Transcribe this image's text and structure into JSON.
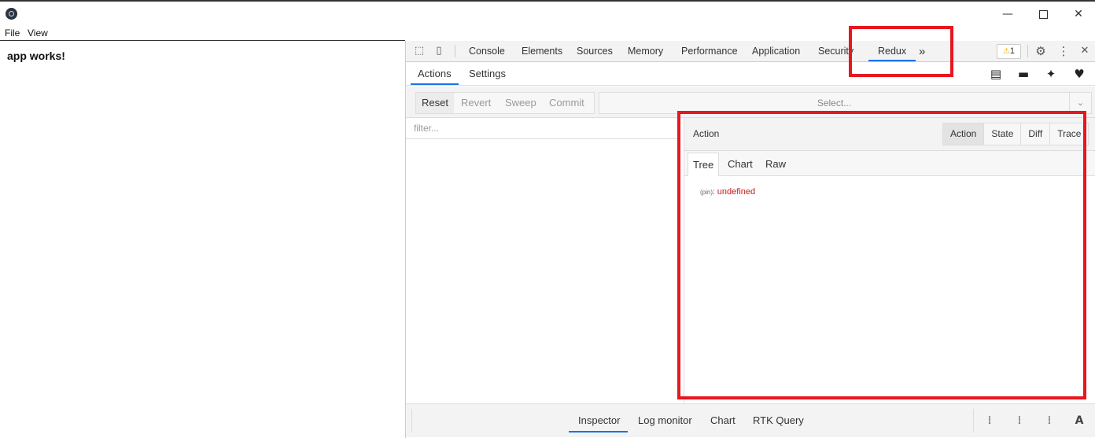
{
  "window": {
    "minimize_glyph": "—",
    "close_glyph": "✕"
  },
  "menu": {
    "file": "File",
    "view": "View"
  },
  "app": {
    "text": "app works!"
  },
  "devtools": {
    "tabs": [
      "Console",
      "Elements",
      "Sources",
      "Memory",
      "Performance",
      "Application",
      "Security",
      "Redux"
    ],
    "more_glyph": "»",
    "warning_count": "1",
    "warning_glyph": "⚠",
    "settings_glyph": "⚙",
    "menu_glyph": "⋮",
    "close_glyph": "✕"
  },
  "redux": {
    "top_tabs": [
      "Actions",
      "Settings"
    ],
    "icons": [
      "book-icon",
      "chat-icon",
      "twitter-icon",
      "heart-icon"
    ],
    "icon_glyphs": {
      "book": "▤",
      "chat": "▬",
      "twitter": "✦",
      "heart": "♥"
    },
    "toolbar": {
      "reset": "Reset",
      "revert": "Revert",
      "sweep": "Sweep",
      "commit": "Commit",
      "select_placeholder": "Select...",
      "select_arrow": "⌄"
    },
    "filter_placeholder": "filter...",
    "right_pane": {
      "title": "Action",
      "tabs": [
        "Action",
        "State",
        "Diff",
        "Trace"
      ],
      "subtabs": [
        "Tree",
        "Chart",
        "Raw"
      ],
      "tree": {
        "key": "(pin)",
        "colon": ":",
        "value": "undefined"
      }
    },
    "bottom_tabs": [
      "Inspector",
      "Log monitor",
      "Chart",
      "RTK Query"
    ]
  },
  "colors": {
    "highlight": "#e8161f",
    "accent": "#1a73e8",
    "value_red": "#c41a16"
  }
}
